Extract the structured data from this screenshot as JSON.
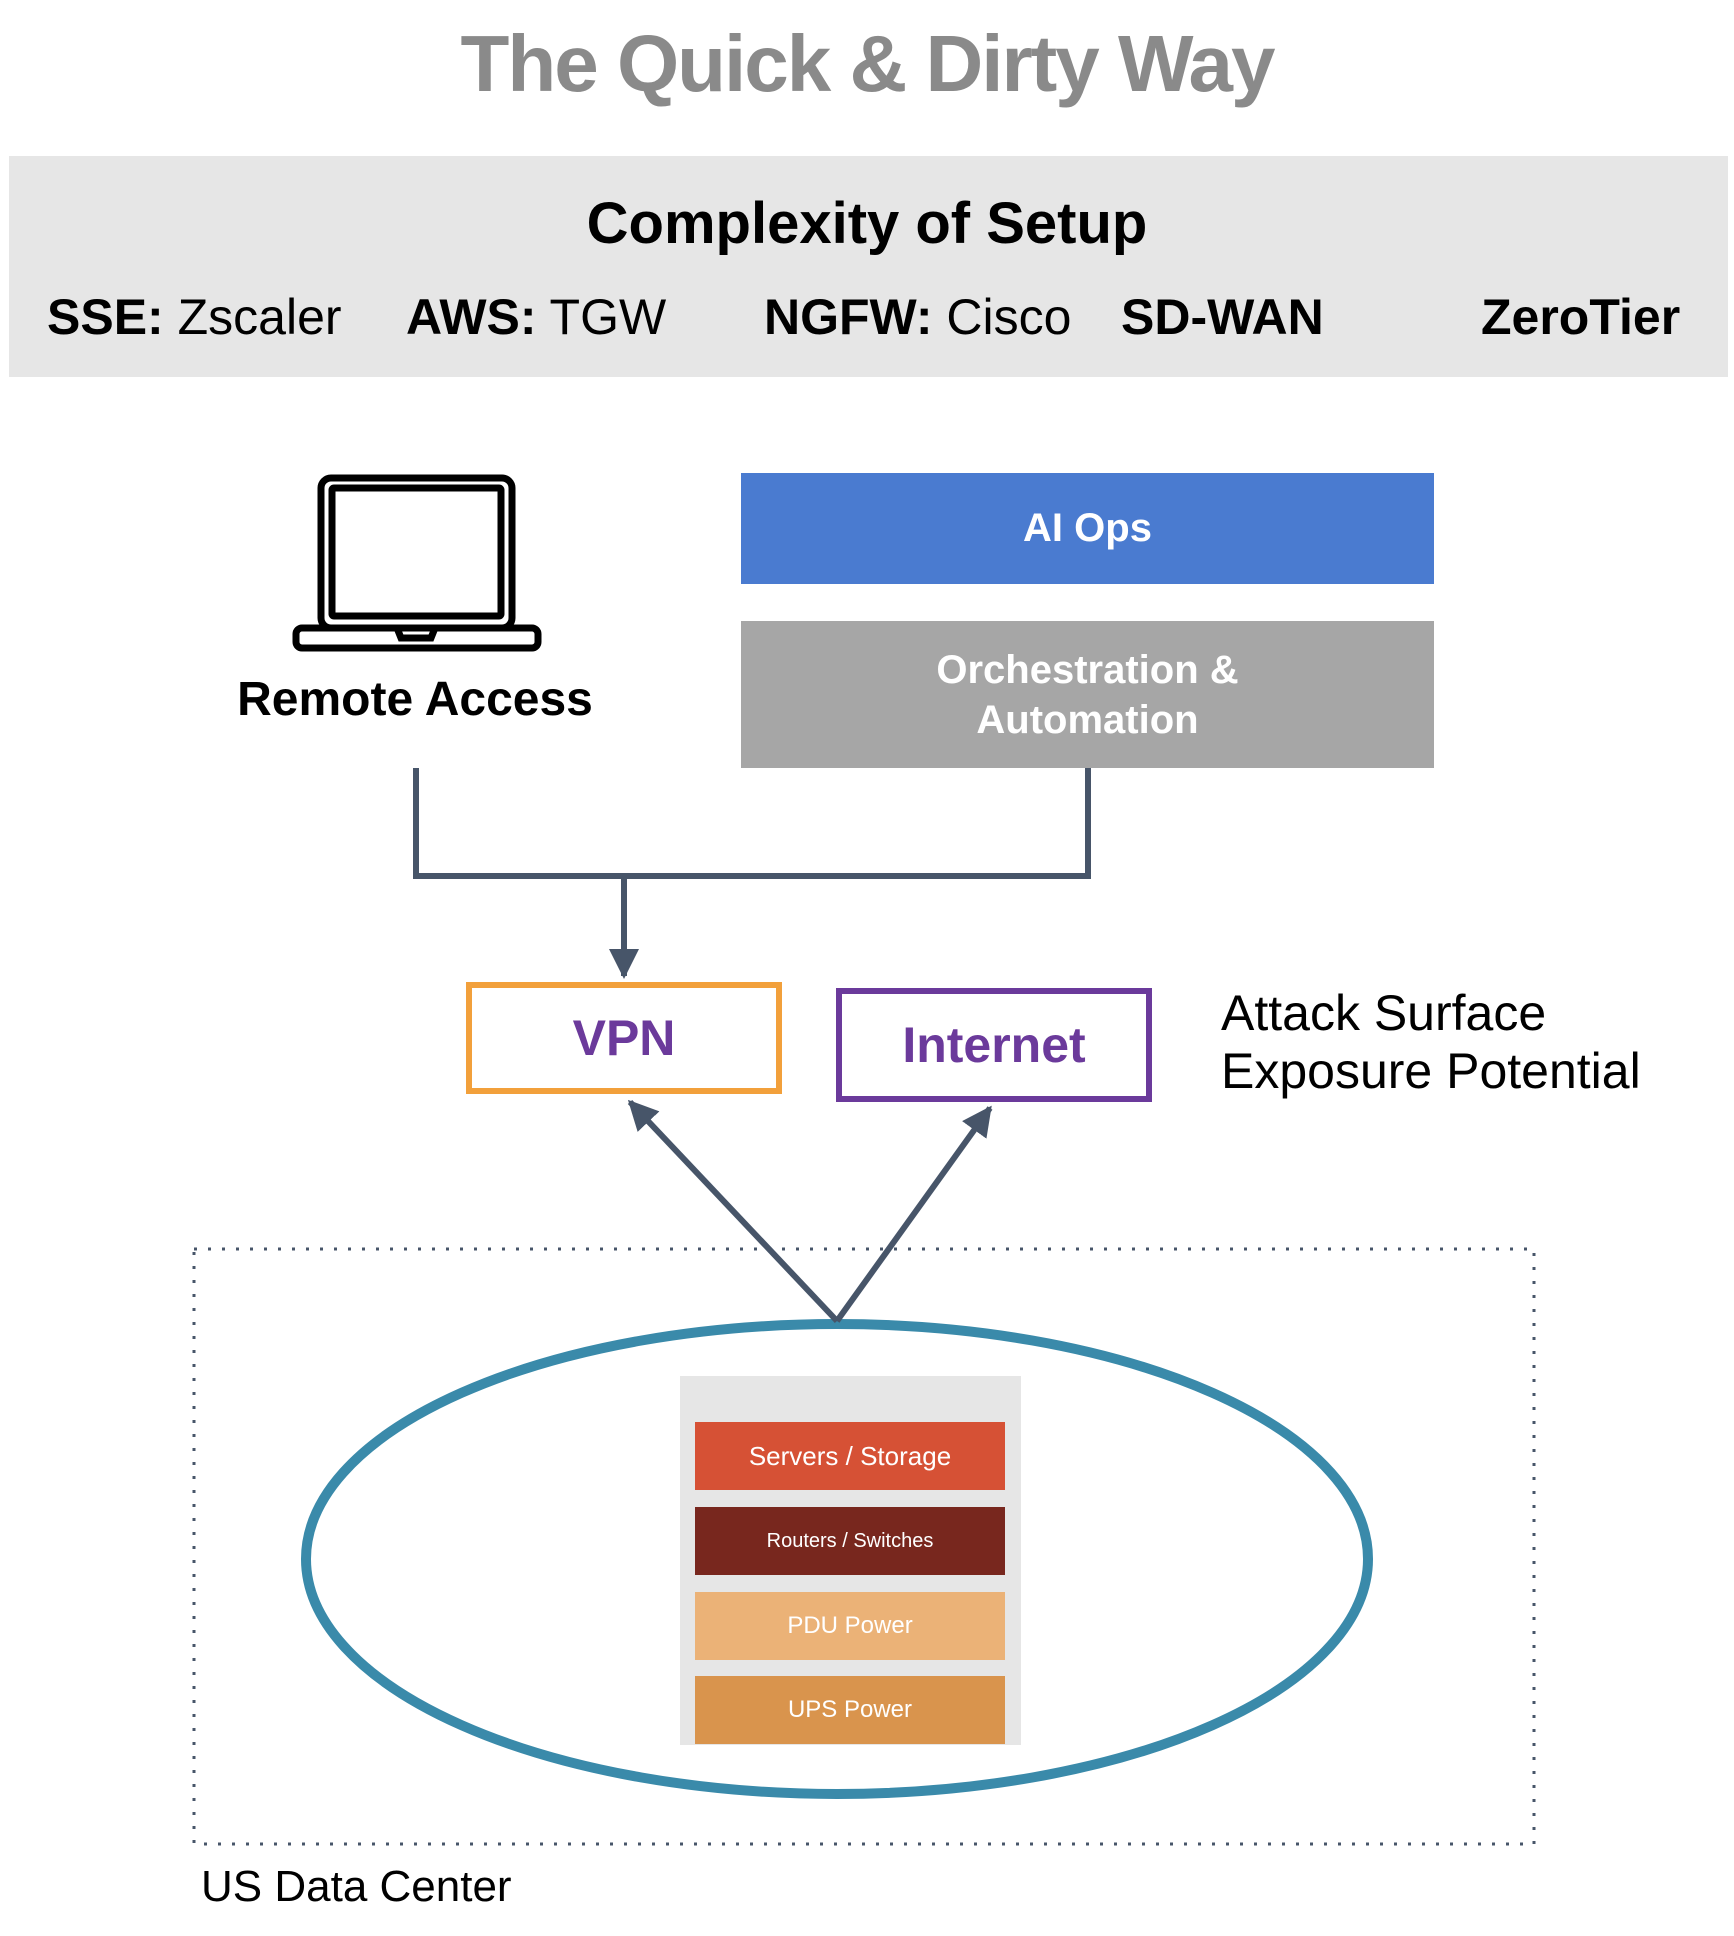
{
  "title": "The Quick & Dirty Way",
  "complexity": {
    "heading": "Complexity of Setup",
    "items": [
      {
        "label": "SSE:",
        "value": "Zscaler"
      },
      {
        "label": "AWS:",
        "value": "TGW"
      },
      {
        "label": "NGFW:",
        "value": "Cisco"
      },
      {
        "label": "SD-WAN",
        "value": ""
      },
      {
        "label": "ZeroTier",
        "value": ""
      }
    ]
  },
  "remote_access": {
    "label": "Remote Access",
    "icon": "laptop-icon"
  },
  "ai_ops": {
    "label": "AI Ops",
    "color": "#4a7bd0"
  },
  "orchestration": {
    "line1": "Orchestration &",
    "line2": "Automation",
    "color": "#a6a6a6"
  },
  "vpn": {
    "label": "VPN",
    "border_color": "#f2a03b",
    "text_color": "#6b3a9b"
  },
  "internet": {
    "label": "Internet",
    "border_color": "#6b3a9b",
    "text_color": "#6b3a9b"
  },
  "attack_surface": {
    "line1": "Attack Surface",
    "line2": "Exposure Potential"
  },
  "data_center": {
    "label": "US Data Center",
    "rack": [
      {
        "label": "Servers / Storage",
        "color": "#d65135"
      },
      {
        "label": "Routers / Switches",
        "color": "#78271e"
      },
      {
        "label": "PDU Power",
        "color": "#ebb277"
      },
      {
        "label": "UPS Power",
        "color": "#d9944d"
      }
    ],
    "ellipse_color": "#3a8aaa"
  },
  "connector_color": "#475569"
}
